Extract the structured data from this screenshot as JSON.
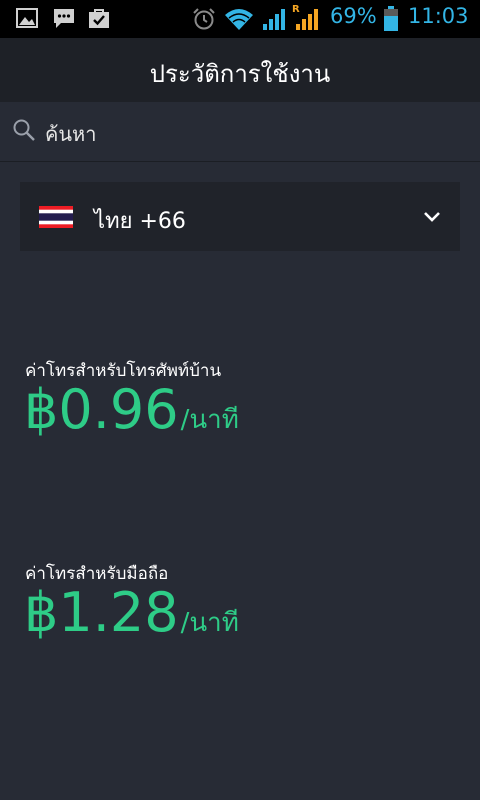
{
  "status_bar": {
    "battery": "69%",
    "time": "11:03",
    "signal_roaming": "R",
    "icons": [
      "gallery-icon",
      "message-icon",
      "store-icon",
      "alarm-icon",
      "wifi-icon",
      "signal-icon",
      "signal-roaming-icon",
      "battery-icon"
    ]
  },
  "header": {
    "title": "ประวัติการใช้งาน"
  },
  "search": {
    "placeholder": "ค้นหา"
  },
  "country": {
    "label": "ไทย +66"
  },
  "rates": [
    {
      "label": "ค่าโทรสำหรับโทรศัพท์บ้าน",
      "amount": "฿0.96",
      "unit": "/นาที"
    },
    {
      "label": "ค่าโทรสำหรับมือถือ",
      "amount": "฿1.28",
      "unit": "/นาที"
    }
  ],
  "colors": {
    "background": "#272b35",
    "header": "#1e2127",
    "accent_green": "#2ecc87",
    "status_blue": "#33b5e5",
    "signal_orange": "#f5a623"
  }
}
